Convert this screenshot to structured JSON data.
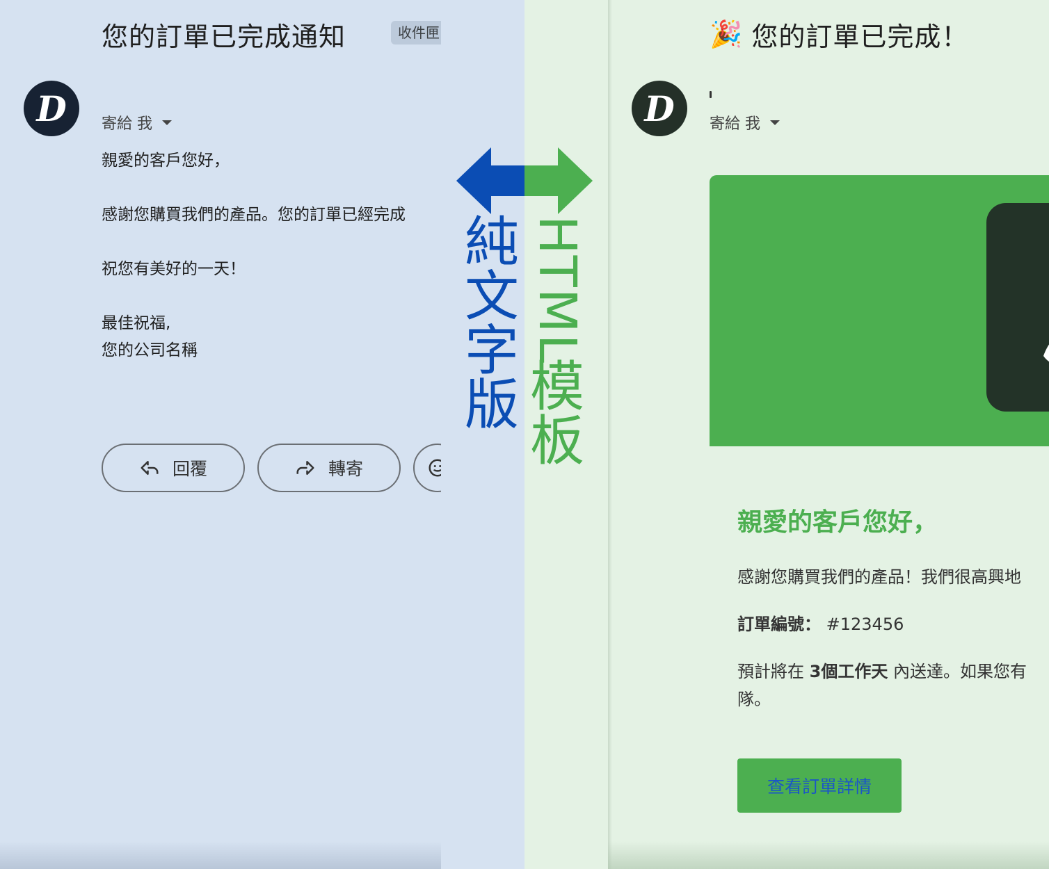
{
  "colors": {
    "left_bg": "#d6e2f1",
    "right_bg": "#e4f2e4",
    "plain_text_accent": "#0b4db4",
    "html_accent": "#4caf50",
    "cta_text": "#1a56c7"
  },
  "plain_text": {
    "subject": "您的訂單已完成通知",
    "label_chip": "收件匣",
    "avatar_letter": "D",
    "to_label": "寄給 我",
    "body": {
      "greeting": "親愛的客戶您好，",
      "thanks": "感謝您購買我們的產品。您的訂單已經完成",
      "wish": "祝您有美好的一天！",
      "sign_off": "最佳祝福,",
      "company": "您的公司名稱"
    },
    "actions": {
      "reply": "回覆",
      "forward": "轉寄"
    }
  },
  "center": {
    "plain_label": [
      "純",
      "文",
      "字",
      "版"
    ],
    "html_label_latin": "HTML",
    "html_label_cjk": [
      "模",
      "板"
    ]
  },
  "html_template": {
    "subject_emoji": "🎉",
    "subject": "您的訂單已完成！",
    "avatar_letter": "D",
    "to_label": "寄給 我",
    "greeting": "親愛的客戶您好，",
    "thanks": "感謝您購買我們的產品！我們很高興地",
    "order_label": "訂單編號：",
    "order_number": "#123456",
    "delivery_prefix": "預計將在",
    "delivery_days": "3個工作天",
    "delivery_suffix": "內送達。如果您有",
    "delivery_tail": "隊。",
    "cta_label": "查看訂單詳情"
  }
}
